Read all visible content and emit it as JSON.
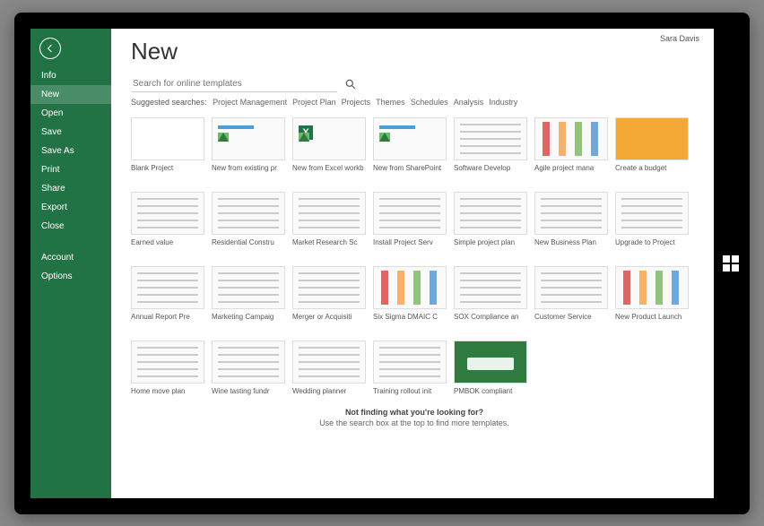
{
  "user": "Sara Davis",
  "page_title": "New",
  "sidebar": {
    "items": [
      {
        "label": "Info"
      },
      {
        "label": "New",
        "active": true
      },
      {
        "label": "Open"
      },
      {
        "label": "Save"
      },
      {
        "label": "Save As"
      },
      {
        "label": "Print"
      },
      {
        "label": "Share"
      },
      {
        "label": "Export"
      },
      {
        "label": "Close"
      }
    ],
    "bottom": [
      {
        "label": "Account"
      },
      {
        "label": "Options"
      }
    ]
  },
  "search": {
    "placeholder": "Search for online templates"
  },
  "suggested": {
    "label": "Suggested searches:",
    "links": [
      "Project Management",
      "Project Plan",
      "Projects",
      "Themes",
      "Schedules",
      "Analysis",
      "Industry"
    ]
  },
  "templates": [
    {
      "label": "Blank Project",
      "style": "blank"
    },
    {
      "label": "New from existing pr",
      "style": "bars arrow"
    },
    {
      "label": "New from Excel workb",
      "style": "bars arrow excel"
    },
    {
      "label": "New from SharePoint",
      "style": "bars arrow"
    },
    {
      "label": "Software Develop",
      "style": "lines"
    },
    {
      "label": "Agile project mana",
      "style": "cols"
    },
    {
      "label": "Create a budget",
      "style": "orange"
    },
    {
      "label": "Earned value",
      "style": "lines"
    },
    {
      "label": "Residential Constru",
      "style": "lines"
    },
    {
      "label": "Market Research Sc",
      "style": "lines"
    },
    {
      "label": "Install Project Serv",
      "style": "lines"
    },
    {
      "label": "Simple project plan",
      "style": "lines"
    },
    {
      "label": "New Business Plan",
      "style": "lines"
    },
    {
      "label": "Upgrade to Project",
      "style": "lines"
    },
    {
      "label": "Annual Report Pre",
      "style": "lines"
    },
    {
      "label": "Marketing Campaig",
      "style": "lines"
    },
    {
      "label": "Merger or Acquisiti",
      "style": "lines"
    },
    {
      "label": "Six Sigma DMAIC C",
      "style": "cols"
    },
    {
      "label": "SOX Compliance an",
      "style": "lines"
    },
    {
      "label": "Customer Service",
      "style": "lines"
    },
    {
      "label": "New Product Launch",
      "style": "cols"
    },
    {
      "label": "Home move plan",
      "style": "lines"
    },
    {
      "label": "Wine tasting fundr",
      "style": "lines"
    },
    {
      "label": "Wedding planner",
      "style": "lines"
    },
    {
      "label": "Training rollout init",
      "style": "lines"
    },
    {
      "label": "PMBOK compliant",
      "style": "greencard"
    }
  ],
  "footer": {
    "question": "Not finding what you're looking for?",
    "hint": "Use the search box at the top to find more templates."
  }
}
